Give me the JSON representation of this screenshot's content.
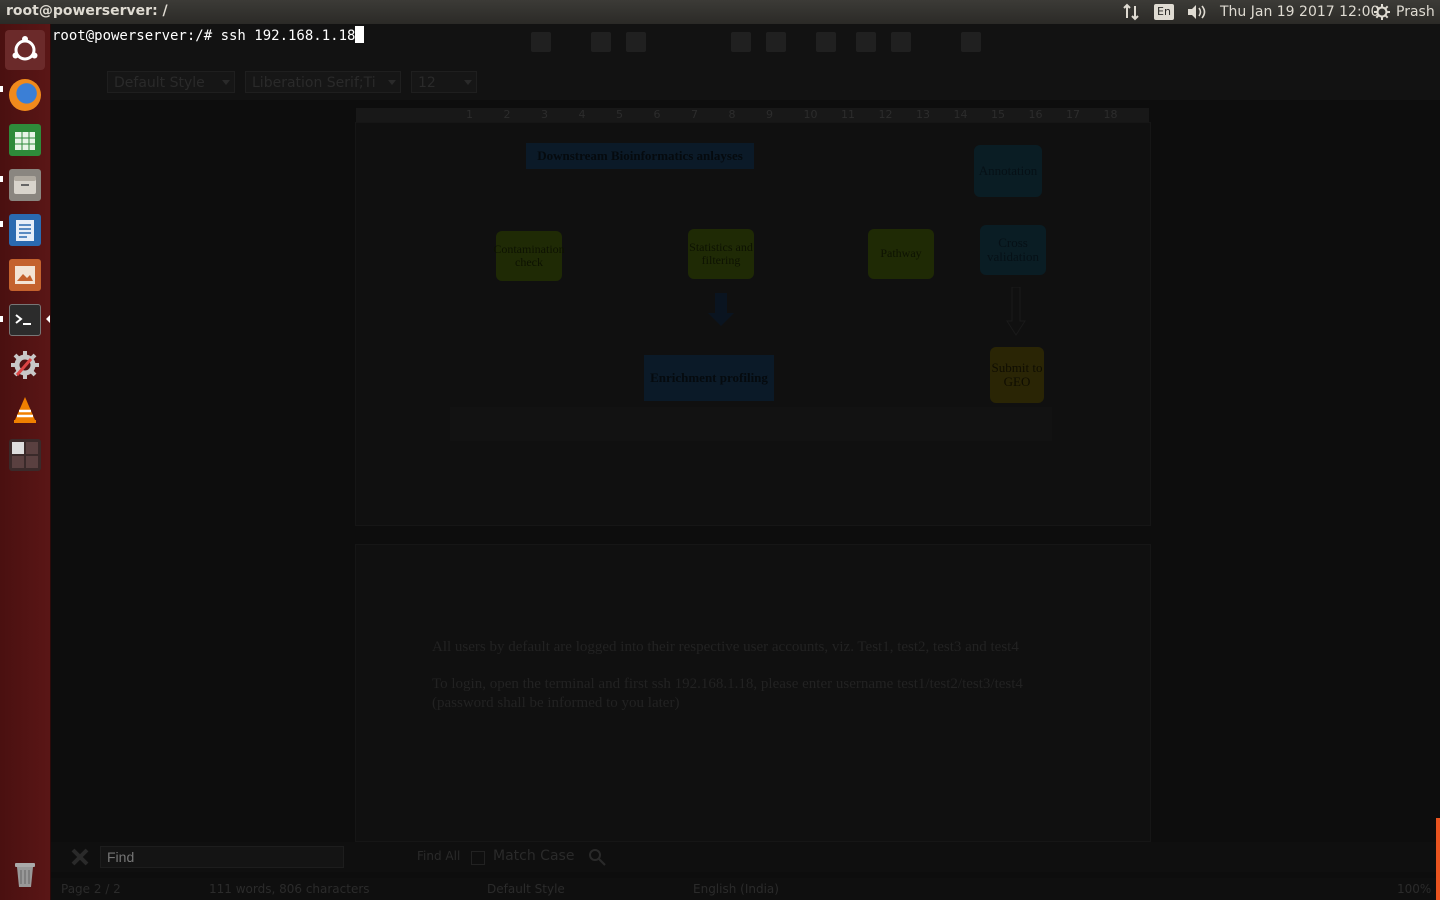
{
  "top_panel": {
    "window_title": "root@powerserver: /",
    "keyboard_layout": "En",
    "datetime": "Thu Jan 19 2017 12:00",
    "user": "Prash"
  },
  "launcher": {
    "items": [
      {
        "name": "ubuntu-dash-icon"
      },
      {
        "name": "firefox-icon"
      },
      {
        "name": "libreoffice-calc-icon"
      },
      {
        "name": "files-icon"
      },
      {
        "name": "libreoffice-writer-icon"
      },
      {
        "name": "image-viewer-icon"
      },
      {
        "name": "terminal-icon"
      },
      {
        "name": "system-settings-icon"
      },
      {
        "name": "vlc-icon"
      },
      {
        "name": "workspace-switcher-icon"
      },
      {
        "name": "trash-icon"
      }
    ]
  },
  "terminal": {
    "prompt": "root@powerserver:/# ",
    "command": "ssh 192.168.1.18"
  },
  "writer": {
    "paragraph_style": "Default Style",
    "font_name": "Liberation Serif;Ti",
    "font_size": "12",
    "ruler_numbers": [
      "1",
      "2",
      "3",
      "4",
      "5",
      "6",
      "7",
      "8",
      "9",
      "10",
      "11",
      "12",
      "13",
      "14",
      "15",
      "16",
      "17",
      "18"
    ],
    "diagram": {
      "downstream": "Downstream Bioinformatics anlayses",
      "annotation": "Annotation",
      "contamination": "Contamination check",
      "statistics": "Statistics and filtering",
      "pathway": "Pathway",
      "cross_validation": "Cross validation",
      "enrichment": "Enrichment profiling",
      "submit": "Submit to GEO"
    },
    "doc_paragraphs": {
      "p1": "All users by default are logged into their respective user accounts, viz. Test1, test2, test3 and test4",
      "p2": "To login, open the terminal and first ssh 192.168.1.18, please enter username test1/test2/test3/test4",
      "p3": "(password shall be informed to you later)"
    },
    "find_bar": {
      "placeholder": "Find",
      "find_all": "Find All",
      "match_case": "Match Case"
    },
    "status": {
      "page": "Page 2 / 2",
      "words": "111 words, 806 characters",
      "style": "Default Style",
      "language": "English (India)",
      "zoom": "100%"
    }
  }
}
